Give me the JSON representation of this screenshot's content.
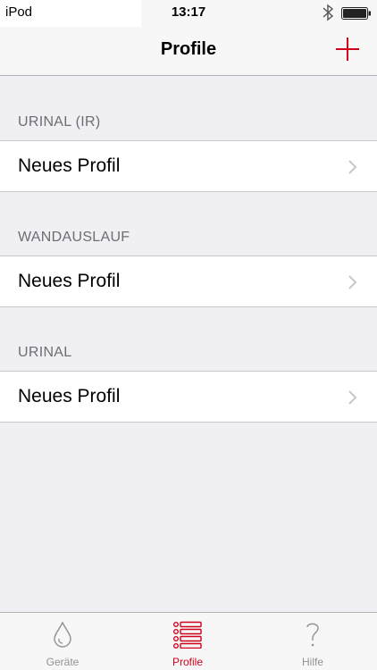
{
  "status_bar": {
    "carrier": "iPod",
    "time": "13:17"
  },
  "nav": {
    "title": "Profile",
    "add_icon": "plus-icon"
  },
  "sections": [
    {
      "header": "URINAL (IR)",
      "rows": [
        {
          "label": "Neues Profil"
        }
      ]
    },
    {
      "header": "WANDAUSLAUF",
      "rows": [
        {
          "label": "Neues Profil"
        }
      ]
    },
    {
      "header": "URINAL",
      "rows": [
        {
          "label": "Neues Profil"
        }
      ]
    }
  ],
  "tab_bar": {
    "tabs": [
      {
        "label": "Geräte",
        "icon": "drop-icon",
        "active": false
      },
      {
        "label": "Profile",
        "icon": "list-icon",
        "active": true
      },
      {
        "label": "Hilfe",
        "icon": "question-icon",
        "active": false
      }
    ]
  },
  "colors": {
    "accent": "#d0021b",
    "background": "#efeff4",
    "section_header_text": "#6d6d72",
    "inactive_tab": "#929292"
  }
}
